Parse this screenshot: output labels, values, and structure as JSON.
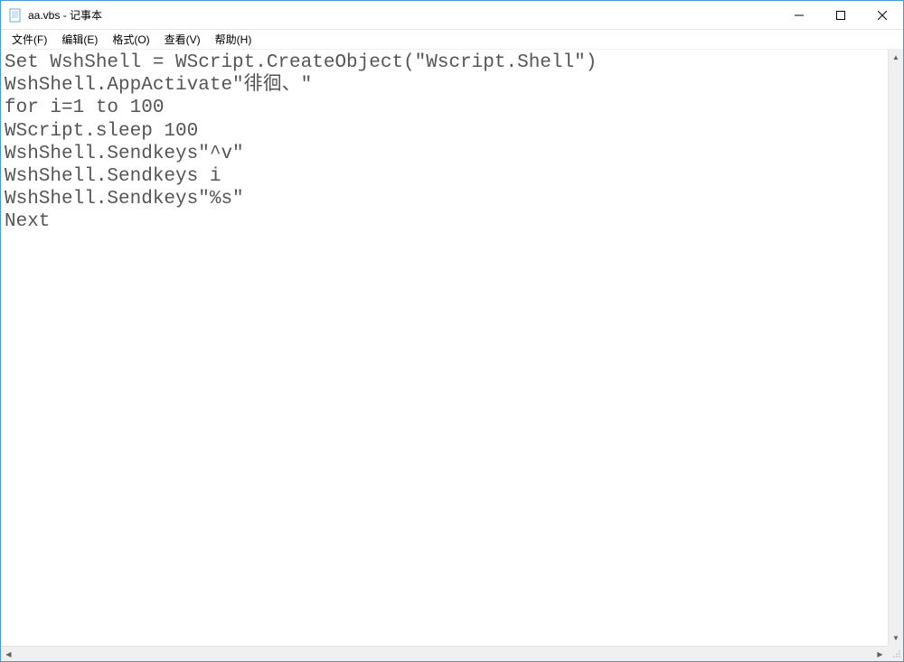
{
  "titlebar": {
    "title": "aa.vbs - 记事本"
  },
  "menubar": {
    "file": "文件(F)",
    "edit": "编辑(E)",
    "format": "格式(O)",
    "view": "查看(V)",
    "help": "帮助(H)"
  },
  "content": {
    "text": "Set WshShell = WScript.CreateObject(\"Wscript.Shell\")\nWshShell.AppActivate\"徘徊、\"\nfor i=1 to 100\nWScript.sleep 100\nWshShell.Sendkeys\"^v\"\nWshShell.Sendkeys i\nWshShell.Sendkeys\"%s\"\nNext"
  }
}
